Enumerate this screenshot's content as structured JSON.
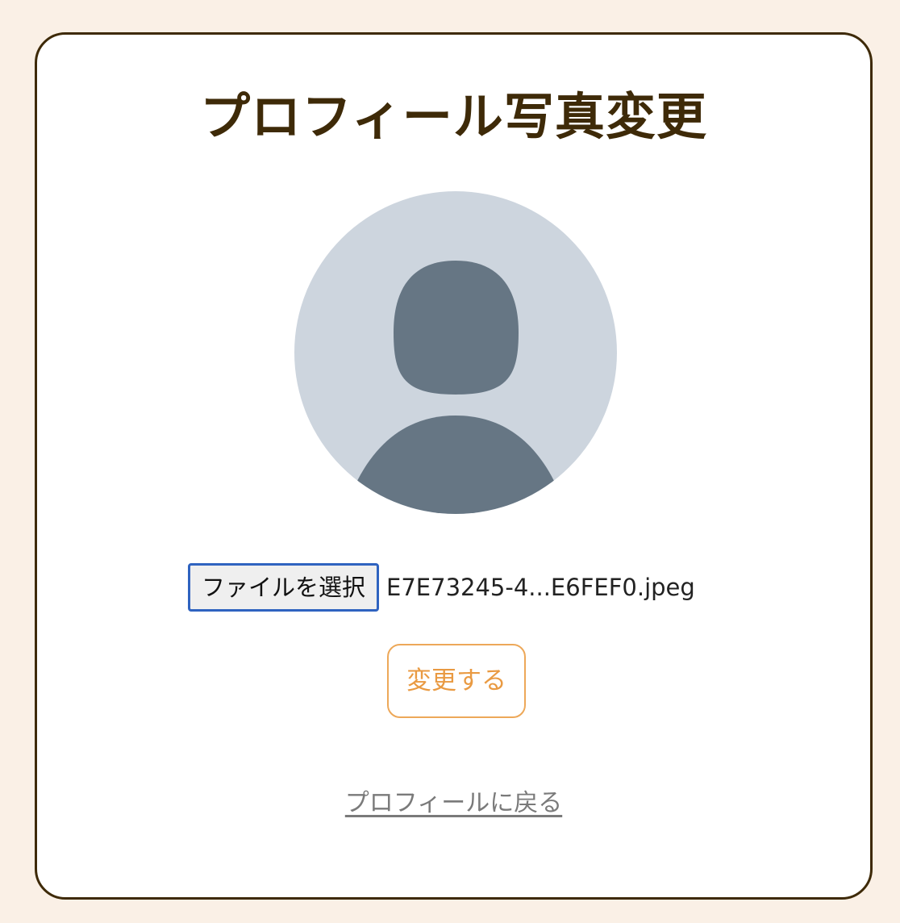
{
  "page": {
    "title": "プロフィール写真変更"
  },
  "avatar": {
    "icon": "user-silhouette-icon",
    "background_color": "#cdd5de",
    "figure_color": "#667684"
  },
  "file_input": {
    "button_label": "ファイルを選択",
    "file_name": "E7E73245-4...E6FEF0.jpeg"
  },
  "actions": {
    "submit_label": "変更する",
    "back_label": "プロフィールに戻る"
  },
  "colors": {
    "page_background": "#faf0e6",
    "card_border": "#3e2a08",
    "title": "#3e2a08",
    "accent": "#e99a42",
    "focus_outline": "#2f63c0",
    "link": "#7a7a7a"
  }
}
